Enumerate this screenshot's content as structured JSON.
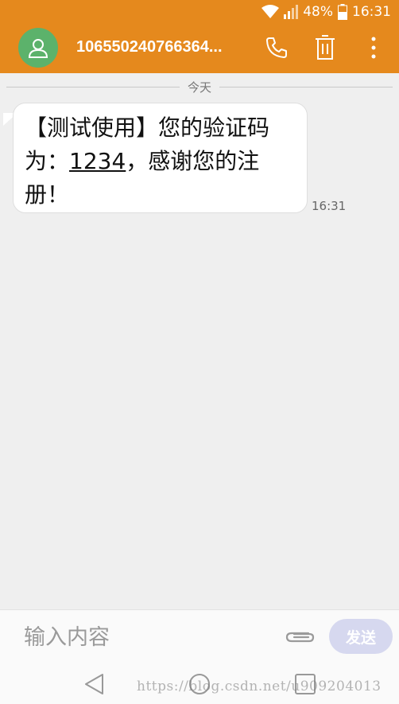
{
  "status_bar": {
    "battery": "48%",
    "time": "16:31"
  },
  "header": {
    "contact": "106550240766364...",
    "icons": [
      "contact-avatar-icon",
      "phone-icon",
      "delete-icon",
      "more-icon"
    ]
  },
  "conversation": {
    "date_label": "今天",
    "messages": [
      {
        "text_before": "【测试使用】您的验证码为：",
        "code": "1234",
        "text_after": "，感谢您的注册！",
        "time": "16:31"
      }
    ]
  },
  "composer": {
    "placeholder": "输入内容",
    "send_label": "发送"
  },
  "watermark": "https://blog.csdn.net/u909204013",
  "colors": {
    "accent": "#e5891d",
    "avatar": "#5cb26b",
    "send_disabled": "#d6d8ef",
    "background": "#efefef"
  }
}
